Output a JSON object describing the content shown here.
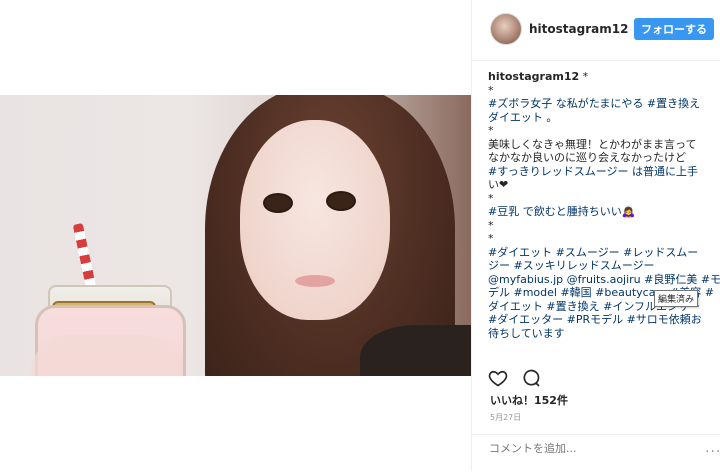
{
  "post": {
    "username": "hitostagram12",
    "follow_label": "フォローする"
  },
  "caption": {
    "username": "hitostagram12",
    "asterisk_after_name": " *",
    "lines": [
      "*",
      "#ズボラ女子 な私がたまにやる #置き換え",
      "ダイエット 。",
      "*",
      "美味しくなきゃ無理！とかわがまま言って",
      "なかなか良いのに巡り会えなかったけど",
      "#すっきりレッドスムージー は普通に上手",
      "い❤",
      "*",
      "#豆乳 で飲むと腫持ちいい🙇‍♀️",
      "*",
      "*",
      "#ダイエット #スムージー #レッドスムー",
      "ジー #スッキリレッドスムージー",
      "@myfabius.jp @fruits.aojiru #良野仁美 #モ",
      "デル #model #韓国 #beautycare #美容 #",
      "ダイエット #置き換え #インフルエンサー",
      "#ダイエッター #PRモデル #サロモ依頼お",
      "待ちしています"
    ],
    "tooltip": "編集済み"
  },
  "engagement": {
    "likes_label": "いいね！152件",
    "date": "5月27日",
    "comment_placeholder": "コメントを追加...",
    "more_label": "..."
  },
  "icons": {
    "like": "heart-icon",
    "comment": "comment-icon",
    "more": "more-options-icon"
  },
  "colors": {
    "accent": "#3897f0",
    "hashtag": "#003569",
    "muted": "#999999"
  }
}
